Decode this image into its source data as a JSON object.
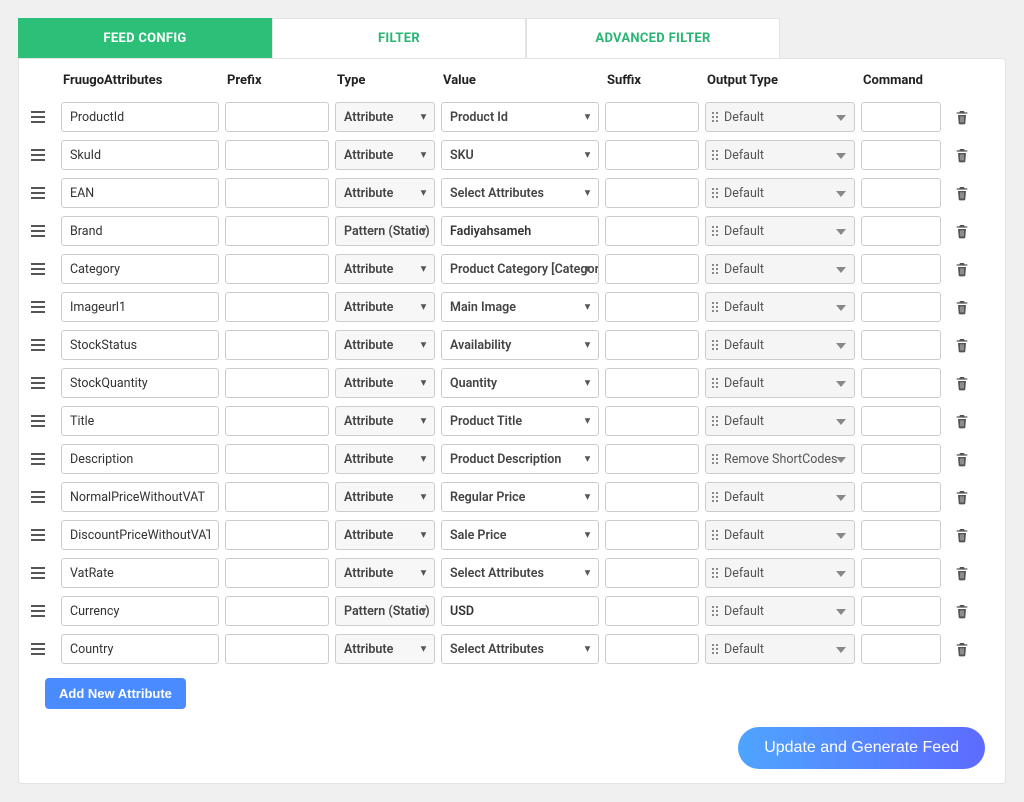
{
  "tabs": {
    "feed_config": "FEED CONFIG",
    "filter": "FILTER",
    "advanced_filter": "ADVANCED FILTER"
  },
  "headers": {
    "attr": "FruugoAttributes",
    "prefix": "Prefix",
    "type": "Type",
    "value": "Value",
    "suffix": "Suffix",
    "output": "Output Type",
    "command": "Command"
  },
  "rows": [
    {
      "attr": "ProductId",
      "prefix": "",
      "type": "Attribute",
      "value": "Product Id",
      "suffix": "",
      "output": "Default",
      "command": ""
    },
    {
      "attr": "SkuId",
      "prefix": "",
      "type": "Attribute",
      "value": "SKU",
      "suffix": "",
      "output": "Default",
      "command": ""
    },
    {
      "attr": "EAN",
      "prefix": "",
      "type": "Attribute",
      "value": "Select Attributes",
      "suffix": "",
      "output": "Default",
      "command": ""
    },
    {
      "attr": "Brand",
      "prefix": "",
      "type": "Pattern (Static)",
      "value": "Fadiyahsameh",
      "suffix": "",
      "output": "Default",
      "command": ""
    },
    {
      "attr": "Category",
      "prefix": "",
      "type": "Attribute",
      "value": "Product Category [Category]",
      "suffix": "",
      "output": "Default",
      "command": ""
    },
    {
      "attr": "Imageurl1",
      "prefix": "",
      "type": "Attribute",
      "value": "Main Image",
      "suffix": "",
      "output": "Default",
      "command": ""
    },
    {
      "attr": "StockStatus",
      "prefix": "",
      "type": "Attribute",
      "value": "Availability",
      "suffix": "",
      "output": "Default",
      "command": ""
    },
    {
      "attr": "StockQuantity",
      "prefix": "",
      "type": "Attribute",
      "value": "Quantity",
      "suffix": "",
      "output": "Default",
      "command": ""
    },
    {
      "attr": "Title",
      "prefix": "",
      "type": "Attribute",
      "value": "Product Title",
      "suffix": "",
      "output": "Default",
      "command": ""
    },
    {
      "attr": "Description",
      "prefix": "",
      "type": "Attribute",
      "value": "Product Description",
      "suffix": "",
      "output": "Remove ShortCodes",
      "command": ""
    },
    {
      "attr": "NormalPriceWithoutVAT",
      "prefix": "",
      "type": "Attribute",
      "value": "Regular Price",
      "suffix": "",
      "output": "Default",
      "command": ""
    },
    {
      "attr": "DiscountPriceWithoutVAT",
      "prefix": "",
      "type": "Attribute",
      "value": "Sale Price",
      "suffix": "",
      "output": "Default",
      "command": ""
    },
    {
      "attr": "VatRate",
      "prefix": "",
      "type": "Attribute",
      "value": "Select Attributes",
      "suffix": "",
      "output": "Default",
      "command": ""
    },
    {
      "attr": "Currency",
      "prefix": "",
      "type": "Pattern (Static)",
      "value": "USD",
      "suffix": "",
      "output": "Default",
      "command": ""
    },
    {
      "attr": "Country",
      "prefix": "",
      "type": "Attribute",
      "value": "Select Attributes",
      "suffix": "",
      "output": "Default",
      "command": ""
    }
  ],
  "buttons": {
    "add": "Add New Attribute",
    "generate": "Update and Generate Feed"
  }
}
